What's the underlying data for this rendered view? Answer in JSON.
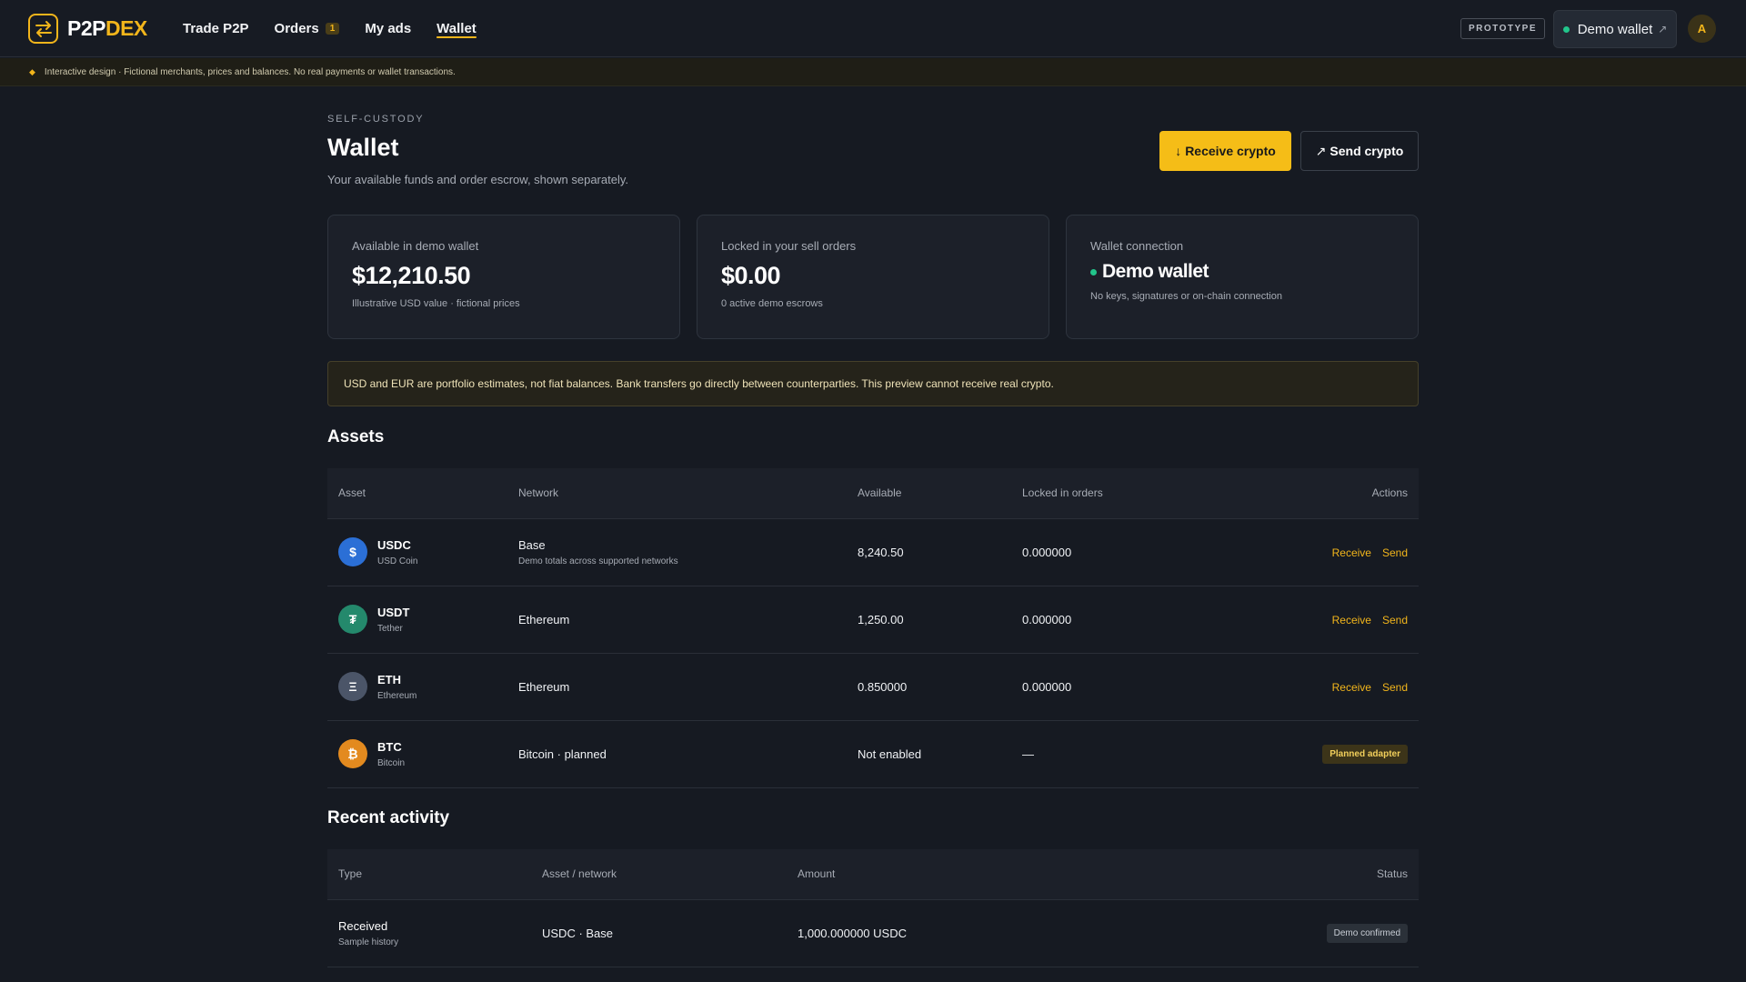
{
  "brand": {
    "name_part1": "P2P",
    "name_part2": "DEX"
  },
  "nav": {
    "items": [
      {
        "label": "Trade P2P"
      },
      {
        "label": "Orders",
        "badge": "1"
      },
      {
        "label": "My ads"
      },
      {
        "label": "Wallet",
        "active": true
      }
    ]
  },
  "header": {
    "prototype_label": "PROTOTYPE",
    "wallet_label": "Demo wallet",
    "avatar_initial": "A"
  },
  "notice": "Interactive design · Fictional merchants, prices and balances. No real payments or wallet transactions.",
  "page": {
    "eyebrow": "SELF-CUSTODY",
    "title": "Wallet",
    "subtitle": "Your available funds and order escrow, shown separately.",
    "receive_label": "Receive crypto",
    "send_label": "Send crypto"
  },
  "cards": [
    {
      "label": "Available in demo wallet",
      "value": "$12,210.50",
      "note": "Illustrative USD value · fictional prices"
    },
    {
      "label": "Locked in your sell orders",
      "value": "$0.00",
      "note": "0 active demo escrows"
    },
    {
      "label": "Wallet connection",
      "value": "Demo wallet",
      "note": "No keys, signatures or on-chain connection"
    }
  ],
  "disclaimer": "USD and EUR are portfolio estimates, not fiat balances. Bank transfers go directly between counterparties. This preview cannot receive real crypto.",
  "assets": {
    "title": "Assets",
    "columns": [
      "Asset",
      "Network",
      "Available",
      "Locked in orders",
      "Actions"
    ],
    "receive_label": "Receive",
    "send_label": "Send",
    "rows": [
      {
        "symbol": "USDC",
        "name": "USD Coin",
        "glyph": "$",
        "network": "Base",
        "network_sub": "Demo totals across supported networks",
        "available": "8,240.50",
        "locked": "0.000000"
      },
      {
        "symbol": "USDT",
        "name": "Tether",
        "glyph": "₮",
        "network": "Ethereum",
        "network_sub": "",
        "available": "1,250.00",
        "locked": "0.000000"
      },
      {
        "symbol": "ETH",
        "name": "Ethereum",
        "glyph": "Ξ",
        "network": "Ethereum",
        "network_sub": "",
        "available": "0.850000",
        "locked": "0.000000"
      },
      {
        "symbol": "BTC",
        "name": "Bitcoin",
        "glyph": "₿",
        "network": "Bitcoin · planned",
        "network_sub": "",
        "available": "Not enabled",
        "locked": "—",
        "action_badge": "Planned adapter"
      }
    ]
  },
  "activity": {
    "title": "Recent activity",
    "columns": [
      "Type",
      "Asset / network",
      "Amount",
      "Status"
    ],
    "rows": [
      {
        "type": "Received",
        "type_sub": "Sample history",
        "asset_network": "USDC · Base",
        "amount": "1,000.000000 USDC",
        "status": "Demo confirmed"
      }
    ]
  }
}
